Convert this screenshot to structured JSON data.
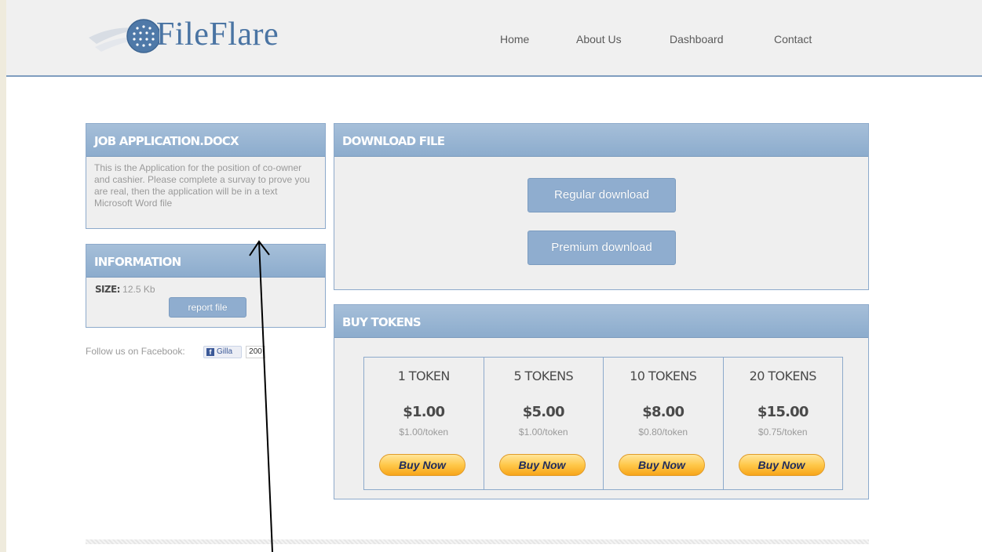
{
  "brand": {
    "name": "FileFlare"
  },
  "nav": {
    "items": [
      "Home",
      "About Us",
      "Dashboard",
      "Contact"
    ]
  },
  "file_panel": {
    "title": "JOB APPLICATION.DOCX",
    "description": "This is the Application for the position of co-owner and cashier. Please complete a survay to prove you are real, then the application will be in a text Microsoft Word file"
  },
  "info_panel": {
    "title": "INFORMATION",
    "size_label": "SIZE:",
    "size_value": " 12.5 Kb",
    "report_label": "report file"
  },
  "facebook": {
    "follow_text": "Follow us on Facebook:",
    "like_label": "Gilla",
    "like_count": "200"
  },
  "download_panel": {
    "title": "DOWNLOAD FILE",
    "regular_label": "Regular download",
    "premium_label": "Premium download"
  },
  "tokens_panel": {
    "title": "BUY TOKENS",
    "packages": [
      {
        "name": "1 TOKEN",
        "price": "$1.00",
        "per": "$1.00/token",
        "buy": "Buy Now"
      },
      {
        "name": "5 TOKENS",
        "price": "$5.00",
        "per": "$1.00/token",
        "buy": "Buy Now"
      },
      {
        "name": "10 TOKENS",
        "price": "$8.00",
        "per": "$0.80/token",
        "buy": "Buy Now"
      },
      {
        "name": "20 TOKENS",
        "price": "$15.00",
        "per": "$0.75/token",
        "buy": "Buy Now"
      }
    ]
  },
  "colors": {
    "accent": "#8caccd",
    "header_bg": "#f0f0f0",
    "panel_bg": "#efefef",
    "buy_button": "#ffc84a"
  },
  "icons": [
    "globe-logo-icon",
    "facebook-icon",
    "arrow-annotation-icon"
  ]
}
